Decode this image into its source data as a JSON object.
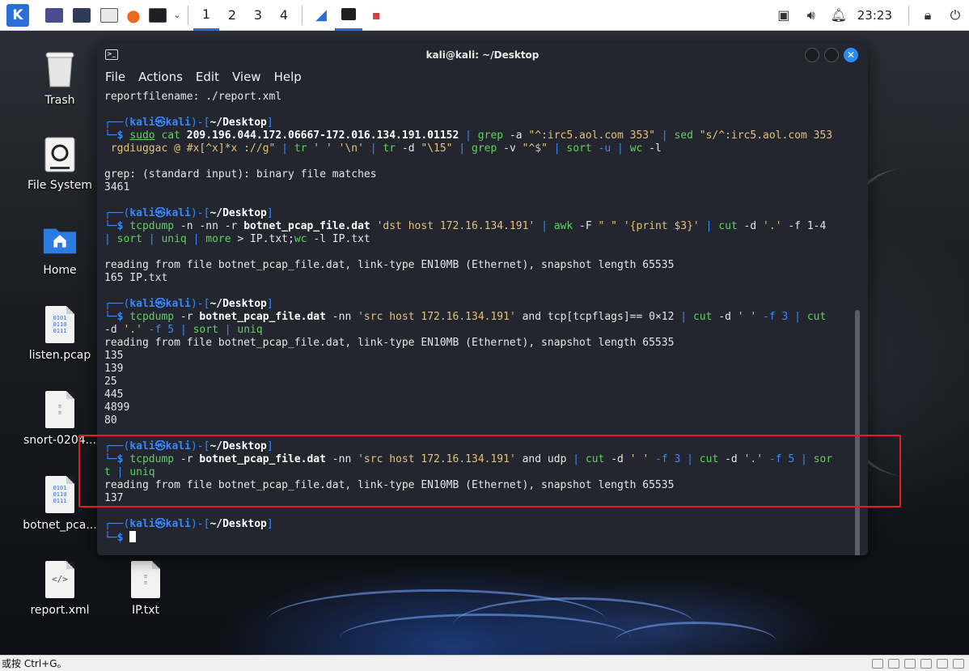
{
  "panel": {
    "workspaces": [
      "1",
      "2",
      "3",
      "4"
    ],
    "active_workspace": "1",
    "clock": "23:23"
  },
  "desktop": {
    "icons": [
      {
        "label": "Trash"
      },
      {
        "label": "File System"
      },
      {
        "label": "Home"
      },
      {
        "label": "listen.pcap"
      },
      {
        "label": "snort-0204..."
      },
      {
        "label": "botnet_pca..."
      },
      {
        "label": "report.xml"
      },
      {
        "label": "IP.txt"
      }
    ]
  },
  "terminal": {
    "title": "kali@kali: ~/Desktop",
    "menu": [
      "File",
      "Actions",
      "Edit",
      "View",
      "Help"
    ],
    "prompt": {
      "user": "kali",
      "at": "㉿",
      "host": "kali",
      "path": "~/Desktop"
    },
    "lines": {
      "l01": "reportfilename: ./report.xml",
      "c1_a": "sudo",
      "c1_b": " cat ",
      "c1_c": "209.196.044.172.06667-172.016.134.191.01152",
      "c1_d": " | ",
      "c1_e": "grep",
      "c1_f": " -a ",
      "c1_g": "\"^:irc5.aol.com 353\"",
      "c1_h": " | ",
      "c1_i": "sed",
      "c1_j": " \"s/^:irc5.aol.com 353",
      "c1_k": " rgdiuggac @ #x[^x]*x ://g\"",
      "c1_l": " | ",
      "c1_m": "tr",
      "c1_n": " ' ' '\\n'",
      "c1_o": " | ",
      "c1_p": "tr",
      "c1_q": " -d ",
      "c1_r": "\"\\15\"",
      "c1_s": " | ",
      "c1_t": "grep",
      "c1_u": " -v ",
      "c1_v": "\"^$\"",
      "c1_w": " | ",
      "c1_x": "sort",
      "c1_y": " -u | ",
      "c1_z": "wc",
      "c1_z2": " -l",
      "o1a": "grep: (standard input): binary file matches",
      "o1b": "3461",
      "c2_a": "tcpdump",
      "c2_b": " -n -nn -r ",
      "c2_c": "botnet_pcap_file.dat",
      "c2_d": " 'dst host 172.16.134.191'",
      "c2_e": " | ",
      "c2_f": "awk",
      "c2_g": " -F ",
      "c2_h": "\" \" '{print $3}'",
      "c2_i": " | ",
      "c2_j": "cut",
      "c2_k": " -d ",
      "c2_l": "'.'",
      "c2_m": " -f 1-4",
      "c2_n": "| ",
      "c2_o": "sort",
      "c2_p": " | ",
      "c2_q": "uniq",
      "c2_r": " | ",
      "c2_s": "more",
      "c2_t": " > IP.txt;",
      "c2_u": "wc",
      "c2_v": " -l IP.txt",
      "o2a": "reading from file botnet_pcap_file.dat, link-type EN10MB (Ethernet), snapshot length 65535",
      "o2b": "165 IP.txt",
      "c3_a": "tcpdump",
      "c3_b": " -r ",
      "c3_c": "botnet_pcap_file.dat",
      "c3_d": " -nn ",
      "c3_e": "'src host 172.16.134.191'",
      "c3_f": " and tcp[tcpflags]== 0×12 ",
      "c3_g": "| ",
      "c3_h": "cut",
      "c3_i": " -d ",
      "c3_j": "' '",
      "c3_k": " -f 3 | ",
      "c3_l": "cut",
      "c3_m": "-d ",
      "c3_n": "'.'",
      "c3_o": " -f 5 | ",
      "c3_p": "sort",
      "c3_q": " | ",
      "c3_r": "uniq",
      "o3a": "reading from file botnet_pcap_file.dat, link-type EN10MB (Ethernet), snapshot length 65535",
      "o3b": "135",
      "o3c": "139",
      "o3d": "25",
      "o3e": "445",
      "o3f": "4899",
      "o3g": "80",
      "c4_a": "tcpdump",
      "c4_b": " -r ",
      "c4_c": "botnet_pcap_file.dat",
      "c4_d": " -nn ",
      "c4_e": "'src host 172.16.134.191'",
      "c4_f": " and udp ",
      "c4_g": "| ",
      "c4_h": "cut",
      "c4_i": " -d ",
      "c4_j": "' '",
      "c4_k": " -f 3 | ",
      "c4_l": "cut",
      "c4_m": " -d ",
      "c4_n": "'.'",
      "c4_o": " -f 5 | ",
      "c4_p": "sor",
      "c4_q": "t",
      "c4_r": " | ",
      "c4_s": "uniq",
      "o4a": "reading from file botnet_pcap_file.dat, link-type EN10MB (Ethernet), snapshot length 65535",
      "o4b": "137"
    }
  },
  "statusbar": {
    "hint": "或按 Ctrl+G。"
  },
  "colors": {
    "accent": "#2b6fd6",
    "prompt_blue": "#3a86ff",
    "highlight_red": "#e02020"
  }
}
